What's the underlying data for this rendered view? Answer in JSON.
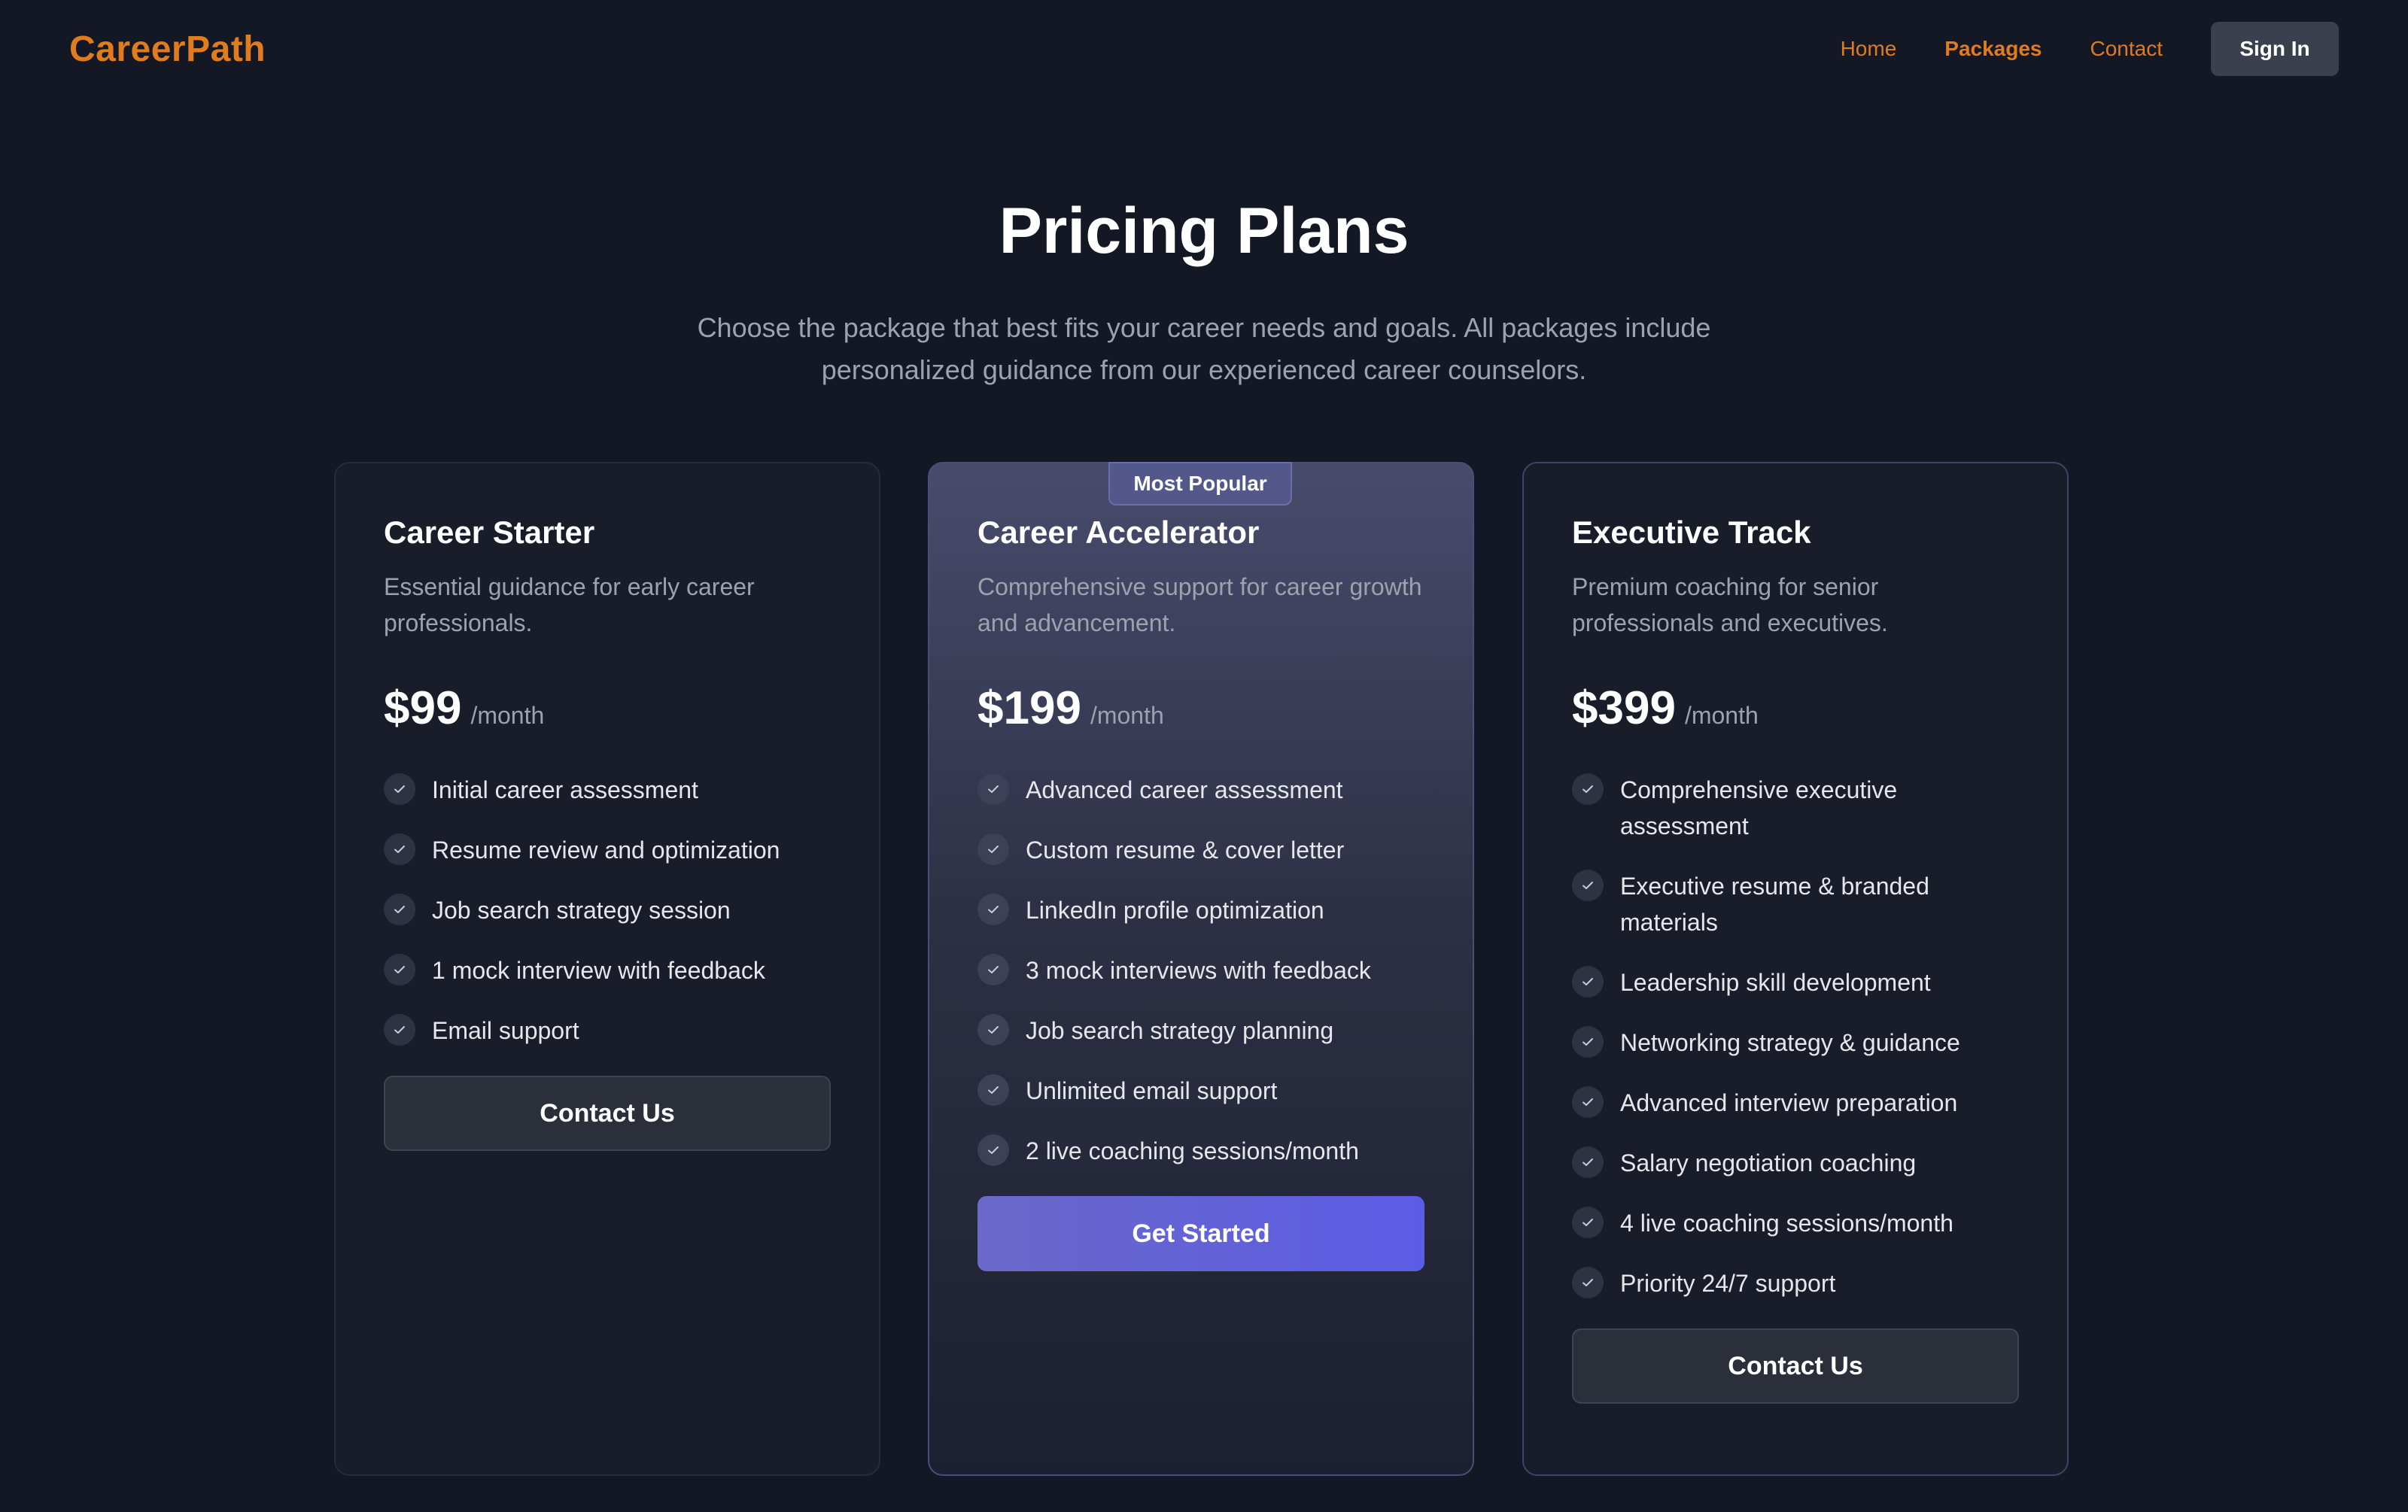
{
  "nav": {
    "logo": "CareerPath",
    "links": [
      "Home",
      "Packages",
      "Contact"
    ],
    "sign_in": "Sign In"
  },
  "hero": {
    "title": "Pricing Plans",
    "subtitle": "Choose the package that best fits your career needs and goals. All packages include personalized guidance from our experienced career counselors."
  },
  "plans": [
    {
      "name": "Career Starter",
      "description": "Essential guidance for early career professionals.",
      "price": "$99",
      "period": "/month",
      "features": [
        "Initial career assessment",
        "Resume review and optimization",
        "Job search strategy session",
        "1 mock interview with feedback",
        "Email support"
      ],
      "cta": "Contact Us"
    },
    {
      "badge": "Most Popular",
      "name": "Career Accelerator",
      "description": "Comprehensive support for career growth and advancement.",
      "price": "$199",
      "period": "/month",
      "features": [
        "Advanced career assessment",
        "Custom resume & cover letter",
        "LinkedIn profile optimization",
        "3 mock interviews with feedback",
        "Job search strategy planning",
        "Unlimited email support",
        "2 live coaching sessions/month"
      ],
      "cta": "Get Started"
    },
    {
      "name": "Executive Track",
      "description": "Premium coaching for senior professionals and executives.",
      "price": "$399",
      "period": "/month",
      "features": [
        "Comprehensive executive assessment",
        "Executive resume & branded materials",
        "Leadership skill development",
        "Networking strategy & guidance",
        "Advanced interview preparation",
        "Salary negotiation coaching",
        "4 live coaching sessions/month",
        "Priority 24/7 support"
      ],
      "cta": "Contact Us"
    }
  ],
  "colors": {
    "accent": "#e07b1e",
    "primary_button": "#5b5ce6",
    "background": "#141824"
  },
  "icons": {
    "feature_check": "check-icon"
  }
}
